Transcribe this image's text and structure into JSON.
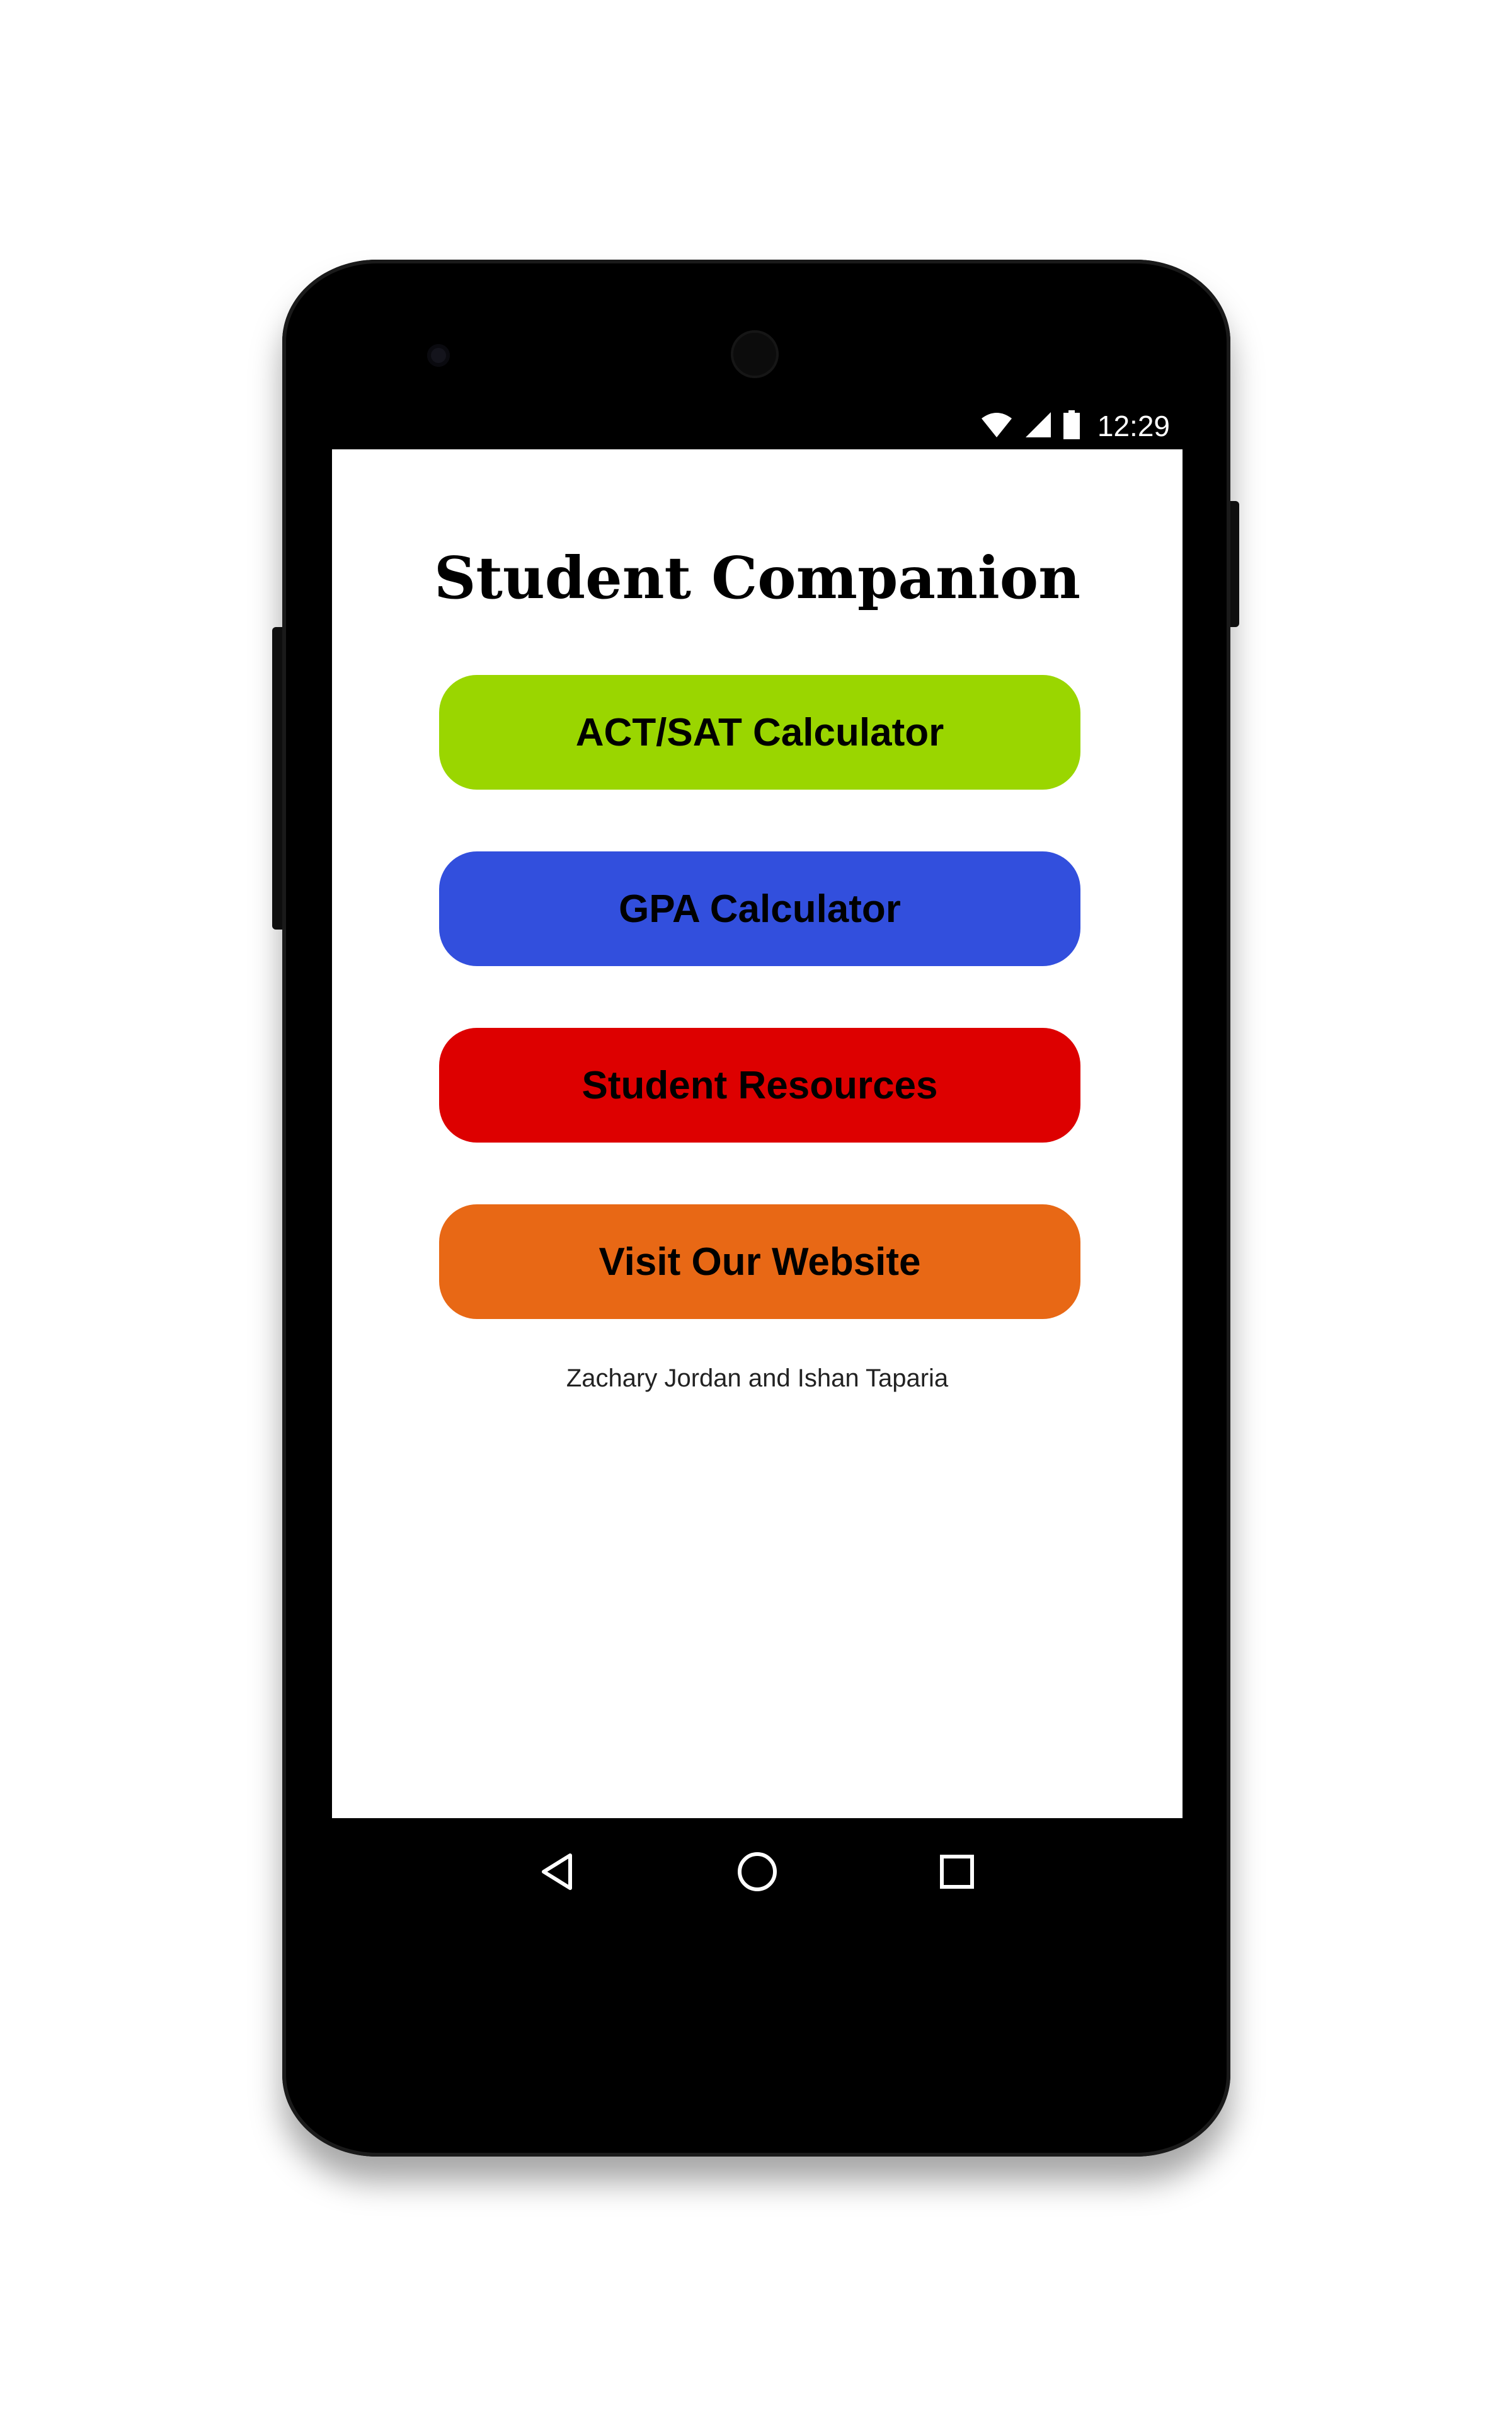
{
  "status_bar": {
    "time": "12:29",
    "icons": [
      "wifi-icon",
      "signal-icon",
      "battery-icon"
    ]
  },
  "app": {
    "title": "Student Companion",
    "buttons": [
      {
        "label": "ACT/SAT Calculator",
        "color": "#9ad600"
      },
      {
        "label": "GPA Calculator",
        "color": "#324fdd"
      },
      {
        "label": "Student Resources",
        "color": "#dd0000"
      },
      {
        "label": "Visit Our Website",
        "color": "#e86815"
      }
    ],
    "credits": "Zachary Jordan and Ishan Taparia"
  },
  "nav_bar": {
    "icons": [
      "back-icon",
      "home-icon",
      "recents-icon"
    ]
  }
}
